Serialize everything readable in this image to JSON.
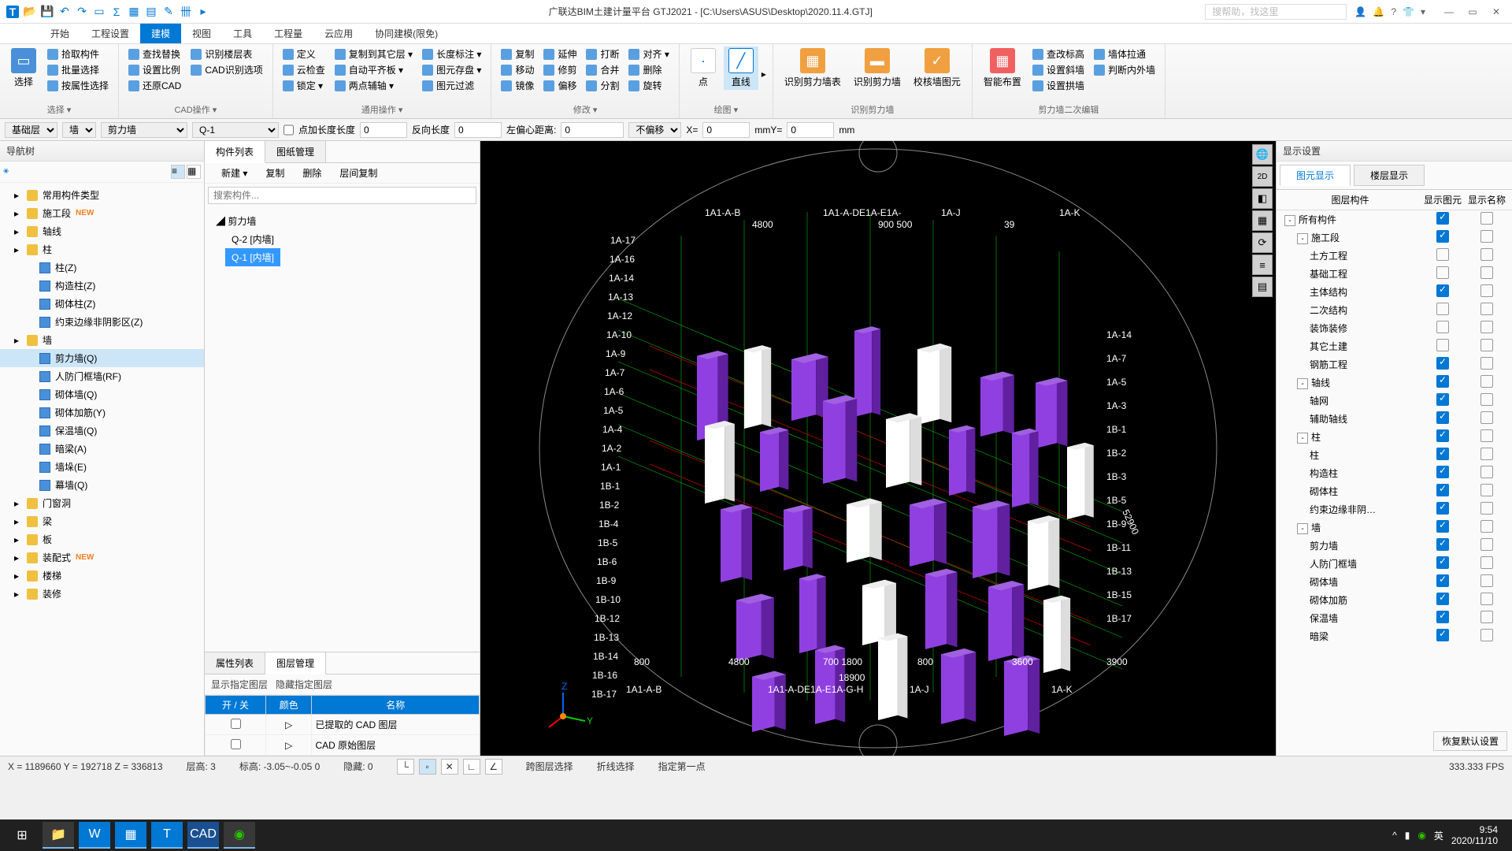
{
  "title": "广联达BIM土建计量平台 GTJ2021 - [C:\\Users\\ASUS\\Desktop\\2020.11.4.GTJ]",
  "menu": [
    "开始",
    "工程设置",
    "建模",
    "视图",
    "工具",
    "工程量",
    "云应用",
    "协同建模(限免)"
  ],
  "menuActive": 2,
  "ribbon": {
    "g1": {
      "big": "选择",
      "items": [
        "拾取构件",
        "批量选择",
        "按属性选择"
      ],
      "label": "选择 ▾"
    },
    "g2": {
      "items": [
        "查找替换",
        "设置比例",
        "还原CAD",
        "识别楼层表",
        "CAD识别选项"
      ],
      "label": "CAD操作 ▾"
    },
    "g3": {
      "items": [
        "定义",
        "云检查",
        "锁定 ▾",
        "复制到其它层 ▾",
        "自动平齐板 ▾",
        "两点辅轴 ▾",
        "长度标注 ▾",
        "图元存盘 ▾",
        "图元过滤"
      ],
      "label": "通用操作 ▾"
    },
    "g4": {
      "items": [
        "复制",
        "移动",
        "镜像",
        "延伸",
        "修剪",
        "偏移",
        "打断",
        "合并",
        "分割",
        "对齐 ▾",
        "删除",
        "旋转"
      ],
      "label": "修改 ▾"
    },
    "g5": {
      "big1": "点",
      "big2": "直线",
      "label": "绘图 ▾"
    },
    "g6": {
      "b1": "识别剪力墙表",
      "b2": "识别剪力墙",
      "b3": "校核墙图元",
      "label": "识别剪力墙"
    },
    "g7": {
      "big": "智能布置",
      "items": [
        "查改标高",
        "设置斜墙",
        "设置拱墙",
        "墙体拉通",
        "判断内外墙"
      ],
      "label": "剪力墙二次编辑"
    }
  },
  "optbar": {
    "sel1": "基础层",
    "sel2": "墙",
    "sel3": "剪力墙",
    "sel4": "Q-1",
    "l1": "点加长度长度",
    "v1": "0",
    "l2": "反向长度",
    "v2": "0",
    "l3": "左偏心距离:",
    "v3": "0",
    "l4": "不偏移",
    "l5": "X=",
    "v5": "0",
    "l6": "mmY=",
    "v6": "0",
    "l7": "mm"
  },
  "nav": {
    "title": "导航树",
    "items": [
      {
        "t": "常用构件类型",
        "cls": "l1",
        "icon": "folder"
      },
      {
        "t": "施工段",
        "cls": "l1",
        "icon": "folder",
        "new": true
      },
      {
        "t": "轴线",
        "cls": "l1",
        "icon": "folder"
      },
      {
        "t": "柱",
        "cls": "l1",
        "icon": "folder"
      },
      {
        "t": "柱(Z)",
        "cls": "l2",
        "icon": "item"
      },
      {
        "t": "构造柱(Z)",
        "cls": "l2",
        "icon": "item"
      },
      {
        "t": "砌体柱(Z)",
        "cls": "l2",
        "icon": "item"
      },
      {
        "t": "约束边缘非阴影区(Z)",
        "cls": "l2",
        "icon": "item"
      },
      {
        "t": "墙",
        "cls": "l1",
        "icon": "folder"
      },
      {
        "t": "剪力墙(Q)",
        "cls": "l2 sel",
        "icon": "item"
      },
      {
        "t": "人防门框墙(RF)",
        "cls": "l2",
        "icon": "item"
      },
      {
        "t": "砌体墙(Q)",
        "cls": "l2",
        "icon": "item"
      },
      {
        "t": "砌体加筋(Y)",
        "cls": "l2",
        "icon": "item"
      },
      {
        "t": "保温墙(Q)",
        "cls": "l2",
        "icon": "item"
      },
      {
        "t": "暗梁(A)",
        "cls": "l2",
        "icon": "item"
      },
      {
        "t": "墙垛(E)",
        "cls": "l2",
        "icon": "item"
      },
      {
        "t": "幕墙(Q)",
        "cls": "l2",
        "icon": "item"
      },
      {
        "t": "门窗洞",
        "cls": "l1",
        "icon": "folder"
      },
      {
        "t": "梁",
        "cls": "l1",
        "icon": "folder"
      },
      {
        "t": "板",
        "cls": "l1",
        "icon": "folder"
      },
      {
        "t": "装配式",
        "cls": "l1",
        "icon": "folder",
        "new": true
      },
      {
        "t": "楼梯",
        "cls": "l1",
        "icon": "folder"
      },
      {
        "t": "装修",
        "cls": "l1",
        "icon": "folder"
      }
    ]
  },
  "comp": {
    "tabs": [
      "构件列表",
      "图纸管理"
    ],
    "tools": [
      "新建 ▾",
      "复制",
      "删除",
      "层间复制"
    ],
    "search": "搜索构件...",
    "root": "剪力墙",
    "items": [
      "Q-2 [内墙]",
      "Q-1 [内墙]"
    ],
    "propsTabs": [
      "属性列表",
      "图层管理"
    ],
    "propSub": [
      "显示指定图层",
      "隐藏指定图层"
    ],
    "cols": [
      "开 / 关",
      "颜色",
      "名称"
    ],
    "rows": [
      "已提取的 CAD 图层",
      "CAD 原始图层"
    ]
  },
  "display": {
    "title": "显示设置",
    "tabs": [
      "图元显示",
      "楼层显示"
    ],
    "cols": [
      "图层构件",
      "显示图元",
      "显示名称"
    ],
    "rows": [
      {
        "t": "所有构件",
        "i": 0,
        "exp": "-",
        "c1": true,
        "c2": false
      },
      {
        "t": "施工段",
        "i": 1,
        "exp": "-",
        "c1": true,
        "c2": false
      },
      {
        "t": "土方工程",
        "i": 2,
        "c1": false,
        "c2": false
      },
      {
        "t": "基础工程",
        "i": 2,
        "c1": false,
        "c2": false
      },
      {
        "t": "主体结构",
        "i": 2,
        "c1": true,
        "c2": false
      },
      {
        "t": "二次结构",
        "i": 2,
        "c1": false,
        "c2": false
      },
      {
        "t": "装饰装修",
        "i": 2,
        "c1": false,
        "c2": false
      },
      {
        "t": "其它土建",
        "i": 2,
        "c1": false,
        "c2": false
      },
      {
        "t": "钢筋工程",
        "i": 2,
        "c1": true,
        "c2": false
      },
      {
        "t": "轴线",
        "i": 1,
        "exp": "-",
        "c1": true,
        "c2": false
      },
      {
        "t": "轴网",
        "i": 2,
        "c1": true,
        "c2": false
      },
      {
        "t": "辅助轴线",
        "i": 2,
        "c1": true,
        "c2": false
      },
      {
        "t": "柱",
        "i": 1,
        "exp": "-",
        "c1": true,
        "c2": false
      },
      {
        "t": "柱",
        "i": 2,
        "c1": true,
        "c2": false
      },
      {
        "t": "构造柱",
        "i": 2,
        "c1": true,
        "c2": false
      },
      {
        "t": "砌体柱",
        "i": 2,
        "c1": true,
        "c2": false
      },
      {
        "t": "约束边缘非阴…",
        "i": 2,
        "c1": true,
        "c2": false
      },
      {
        "t": "墙",
        "i": 1,
        "exp": "-",
        "c1": true,
        "c2": false
      },
      {
        "t": "剪力墙",
        "i": 2,
        "c1": true,
        "c2": false
      },
      {
        "t": "人防门框墙",
        "i": 2,
        "c1": true,
        "c2": false
      },
      {
        "t": "砌体墙",
        "i": 2,
        "c1": true,
        "c2": false
      },
      {
        "t": "砌体加筋",
        "i": 2,
        "c1": true,
        "c2": false
      },
      {
        "t": "保温墙",
        "i": 2,
        "c1": true,
        "c2": false
      },
      {
        "t": "暗梁",
        "i": 2,
        "c1": true,
        "c2": false
      }
    ],
    "restore": "恢复默认设置"
  },
  "status": {
    "coords": "X = 1189660 Y = 192718 Z = 336813",
    "floor": "层高:   3",
    "elev": "标高:   -3.05~-0.05     0",
    "hide": "隐藏:   0",
    "opts": [
      "跨图层选择",
      "折线选择",
      "指定第一点"
    ],
    "fps": "333.333 FPS"
  },
  "taskbar": {
    "ime": "英",
    "time": "9:54",
    "date": "2020/11/10"
  },
  "viewport": {
    "topLabels": [
      "1A1-A-B",
      "1A1-A-DE1A-E1A-",
      "1A-J",
      "1A-K"
    ],
    "topDims": [
      "4800",
      "900 500",
      "39"
    ],
    "leftLabels": [
      "1A-17",
      "1A-16",
      "1A-14",
      "1A-13",
      "1A-12",
      "1A-10",
      "1A-9",
      "1A-7",
      "1A-6",
      "1A-5",
      "1A-4",
      "1A-2",
      "1A-1",
      "1B-1",
      "1B-2",
      "1B-4",
      "1B-5",
      "1B-6",
      "1B-9",
      "1B-10",
      "1B-12",
      "1B-13",
      "1B-14",
      "1B-16",
      "1B-17"
    ],
    "rightLabels": [
      "1A-14",
      "1A-7",
      "1A-5",
      "1A-3",
      "1B-1",
      "1B-2",
      "1B-3",
      "1B-5",
      "1B-9",
      "1B-11",
      "1B-13",
      "1B-15",
      "1B-17"
    ],
    "botDims": [
      "800",
      "4800",
      "700 1800",
      "800",
      "3600",
      "3900"
    ],
    "botDims2": "18900",
    "botLabels": [
      "1A1-A-B",
      "1A1-A-DE1A-E1A-G-H",
      "1A-J",
      "1A-K"
    ],
    "rightDim": "52900"
  }
}
